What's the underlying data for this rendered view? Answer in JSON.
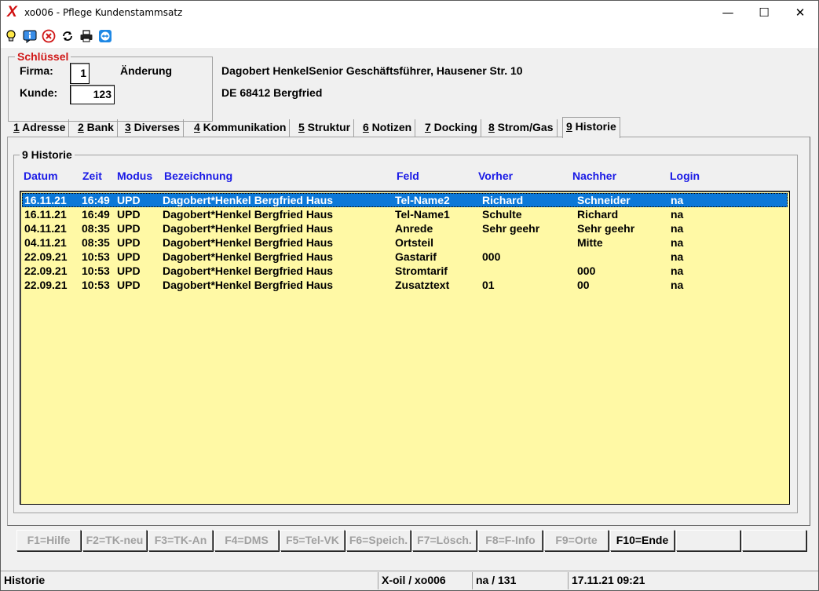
{
  "window": {
    "title": "xo006 - Pflege Kundenstammsatz",
    "app_icon": "X",
    "min_glyph": "—",
    "max_glyph": "☐",
    "close_glyph": "✕"
  },
  "toolbar": {
    "icons": [
      "lightbulb-icon",
      "info-icon",
      "stop-icon",
      "refresh-icon",
      "printer-icon",
      "teamviewer-icon"
    ]
  },
  "schluessel": {
    "legend": "Schlüssel",
    "firma_label": "Firma:",
    "firma_value": "1",
    "mode": "Änderung",
    "kunde_label": "Kunde:",
    "kunde_value": "123"
  },
  "customer": {
    "line1": "Dagobert HenkelSenior Geschäftsführer, Hausener Str. 10",
    "line2": "DE 68412 Bergfried"
  },
  "tabs": [
    {
      "num": "1",
      "label": " Adresse"
    },
    {
      "num": "2",
      "label": " Bank"
    },
    {
      "num": "3",
      "label": " Diverses"
    },
    {
      "num": "4",
      "label": " Kommunikation"
    },
    {
      "num": "5",
      "label": " Struktur"
    },
    {
      "num": "6",
      "label": " Notizen"
    },
    {
      "num": "7",
      "label": " Docking"
    },
    {
      "num": "8",
      "label": " Strom/Gas"
    },
    {
      "num": "9",
      "label": " Historie"
    }
  ],
  "historie": {
    "legend": "9 Historie",
    "columns": [
      "Datum",
      "Zeit",
      "Modus",
      "Bezeichnung",
      "Feld",
      "Vorher",
      "Nachher",
      "Login"
    ],
    "rows": [
      [
        "16.11.21",
        "16:49",
        "UPD",
        "Dagobert*Henkel Bergfried Haus",
        "Tel-Name2",
        "Richard",
        "Schneider",
        "na"
      ],
      [
        "16.11.21",
        "16:49",
        "UPD",
        "Dagobert*Henkel Bergfried Haus",
        "Tel-Name1",
        "Schulte",
        "Richard",
        "na"
      ],
      [
        "04.11.21",
        "08:35",
        "UPD",
        "Dagobert*Henkel Bergfried Haus",
        "Anrede",
        "Sehr geehr",
        "Sehr geehr",
        "na"
      ],
      [
        "04.11.21",
        "08:35",
        "UPD",
        "Dagobert*Henkel Bergfried Haus",
        "Ortsteil",
        "",
        "Mitte",
        "na"
      ],
      [
        "22.09.21",
        "10:53",
        "UPD",
        "Dagobert*Henkel Bergfried Haus",
        "Gastarif",
        "000",
        "",
        "na"
      ],
      [
        "22.09.21",
        "10:53",
        "UPD",
        "Dagobert*Henkel Bergfried Haus",
        "Stromtarif",
        "",
        "000",
        "na"
      ],
      [
        "22.09.21",
        "10:53",
        "UPD",
        "Dagobert*Henkel Bergfried Haus",
        "Zusatztext",
        "01",
        "00",
        "na"
      ]
    ]
  },
  "fkeys": [
    "F1=Hilfe",
    "F2=TK-neu",
    "F3=TK-An",
    "F4=DMS",
    "F5=Tel-VK",
    "F6=Speich.",
    "F7=Lösch.",
    "F8=F-Info",
    "F9=Orte",
    "F10=Ende",
    "",
    ""
  ],
  "status": {
    "panel1": "Historie",
    "panel2": "X-oil / xo006",
    "panel3": "na / 131",
    "panel4": "17.11.21 09:21"
  }
}
